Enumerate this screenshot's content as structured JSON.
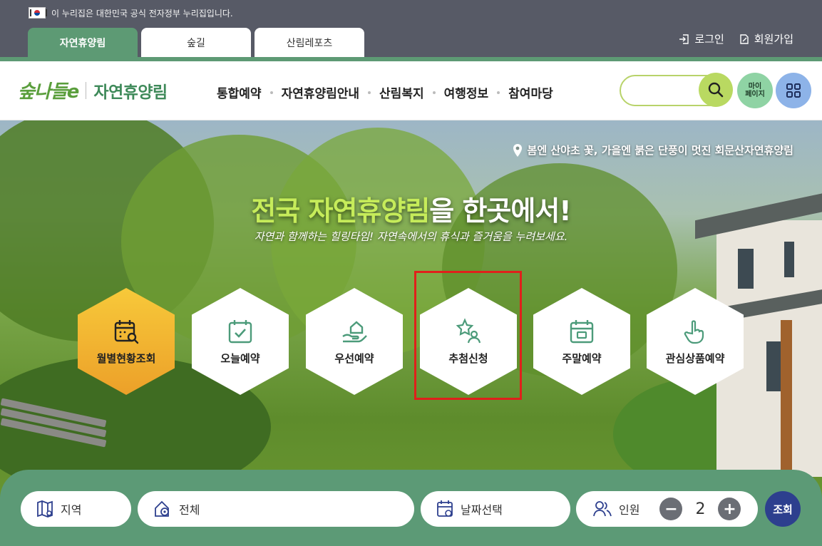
{
  "gov_banner": {
    "text": "이 누리집은 대한민국 공식 전자정부 누리집입니다."
  },
  "site_tabs": [
    {
      "label": "자연휴양림",
      "active": true
    },
    {
      "label": "숲길",
      "active": false
    },
    {
      "label": "산림레포츠",
      "active": false
    }
  ],
  "auth": {
    "login": "로그인",
    "signup": "회원가입"
  },
  "header": {
    "logo_mark": "숲나들e",
    "logo_text": "자연휴양림",
    "nav": [
      "통합예약",
      "자연휴양림안내",
      "산림복지",
      "여행정보",
      "참여마당"
    ],
    "search": {
      "value": "",
      "placeholder": ""
    },
    "mypage_label_line1": "마이",
    "mypage_label_line2": "페이지"
  },
  "hero": {
    "location": "봄엔 산야초 꽃, 가을엔 붉은 단풍이 멋진 회문산자연휴양림",
    "title_highlight": "전국 자연휴양림",
    "title_rest": "을 한곳에서!",
    "subtitle": "자연과 함께하는 힐링타임! 자연속에서의 휴식과 즐거움을 누려보세요."
  },
  "quick_menu": [
    {
      "label": "월별현황조회",
      "icon": "calendar-search-icon",
      "featured": true
    },
    {
      "label": "오늘예약",
      "icon": "calendar-check-icon",
      "featured": false
    },
    {
      "label": "우선예약",
      "icon": "hand-house-icon",
      "featured": false
    },
    {
      "label": "추첨신청",
      "icon": "star-person-icon",
      "featured": false,
      "highlighted": true
    },
    {
      "label": "주말예약",
      "icon": "calendar-weekend-icon",
      "featured": false
    },
    {
      "label": "관심상품예약",
      "icon": "pointer-hand-icon",
      "featured": false
    }
  ],
  "search_panel": {
    "region_label": "지역",
    "forest_label": "전체",
    "date_label": "날짜선택",
    "people_label": "인원",
    "people_count": "2",
    "minus": "−",
    "plus": "+",
    "submit": "조회"
  },
  "colors": {
    "accent_green": "#5c9a76",
    "gov_bar": "#575a66",
    "featured_hex": "#eca029",
    "highlight_box": "#e0201b",
    "submit_button": "#2d3f8e"
  }
}
